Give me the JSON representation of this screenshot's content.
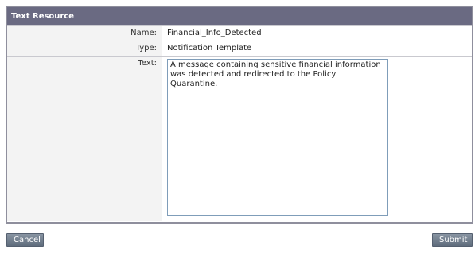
{
  "panel": {
    "title": "Text Resource"
  },
  "fields": {
    "name": {
      "label": "Name:",
      "value": "Financial_Info_Detected"
    },
    "type": {
      "label": "Type:",
      "value": "Notification Template"
    },
    "text": {
      "label": "Text:",
      "value": "A message containing sensitive financial information was detected and redirected to the Policy Quarantine."
    }
  },
  "actions": {
    "cancel_label": "Cancel",
    "submit_label": "Submit"
  },
  "colors": {
    "header_bg": "#6a6a82",
    "button_bg": "#6f7d8c"
  }
}
